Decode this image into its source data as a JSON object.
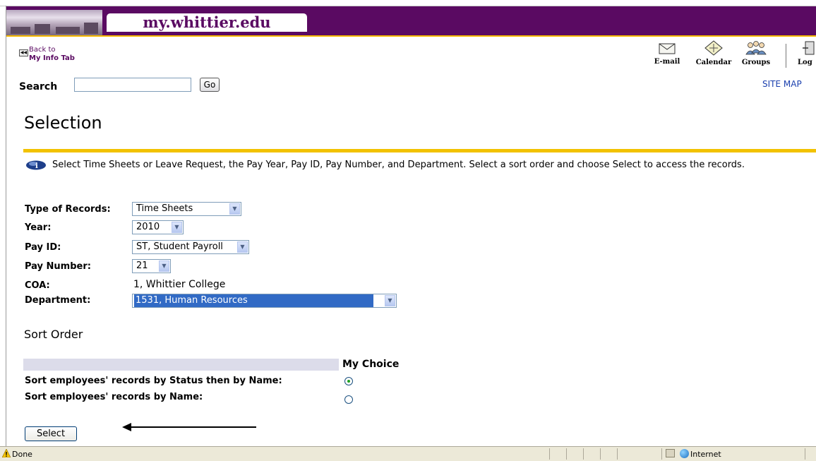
{
  "header": {
    "site_name": "my.whittier.edu"
  },
  "back": {
    "line1": "Back to",
    "line2": "My Info Tab"
  },
  "toolbar": {
    "email": "E-mail",
    "calendar": "Calendar",
    "groups": "Groups",
    "logout_partial": "Log"
  },
  "search": {
    "label": "Search",
    "value": "",
    "go": "Go"
  },
  "site_map": "SITE MAP",
  "page_title": "Selection",
  "instructions": "Select Time Sheets or Leave Request, the Pay Year, Pay ID, Pay Number, and Department. Select a sort order and choose Select to access the records.",
  "form": {
    "type_label": "Type of Records:",
    "type_value": "Time Sheets",
    "year_label": "Year:",
    "year_value": "2010",
    "payid_label": "Pay ID:",
    "payid_value": "ST, Student Payroll",
    "paynum_label": "Pay Number:",
    "paynum_value": "21",
    "coa_label": "COA:",
    "coa_value": "1, Whittier College",
    "dept_label": "Department:",
    "dept_value": "1531, Human Resources"
  },
  "sort": {
    "title": "Sort Order",
    "header": "My Choice",
    "option1": "Sort employees' records by Status then by Name:",
    "option2": "Sort employees' records by Name:",
    "selected": 1
  },
  "select_button": "Select",
  "status": {
    "text": "Done",
    "zone": "Internet"
  },
  "colors": {
    "brand": "#5a0a62",
    "accent": "#f2c200",
    "link": "#1a3fae"
  }
}
